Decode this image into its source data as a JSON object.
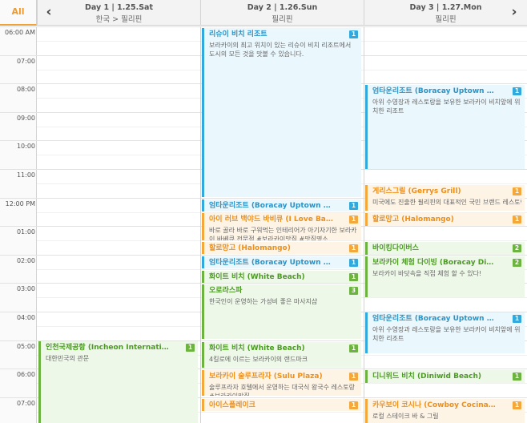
{
  "header": {
    "all_label": "All",
    "prev_icon": "‹",
    "next_icon": "›",
    "days": [
      {
        "title": "Day 1  |  1.25.Sat",
        "subtitle": "한국 > 필리핀"
      },
      {
        "title": "Day 2  |  1.26.Sun",
        "subtitle": "필리핀"
      },
      {
        "title": "Day 3  |  1.27.Mon",
        "subtitle": "필리핀"
      }
    ]
  },
  "times": [
    "06:00 AM",
    "07:00",
    "08:00",
    "09:00",
    "10:00",
    "11:00",
    "12:00 PM",
    "01:00",
    "02:00",
    "03:00",
    "04:00",
    "05:00",
    "06:00",
    "07:00"
  ],
  "colors": {
    "blue": "#32a9dc",
    "orange": "#f4a83c",
    "green": "#6cb33f",
    "accent": "#f09a2c"
  },
  "events": [
    {
      "day": 1,
      "color": "green",
      "title": "인천국제공항 (Incheon Internati…",
      "desc": "대한민국의 관문",
      "badge": "1"
    },
    {
      "day": 2,
      "color": "blue",
      "title": "리슈이 비치 리조트",
      "desc": "보라카이의 최고 위치이 있는 리슈이 비치 리조트에서 도시의 모든 것을 맛볼 수 있습니다.",
      "badge": "1"
    },
    {
      "day": 2,
      "color": "blue",
      "title": "엄타운리조트 (Boracay Uptown …",
      "desc": "",
      "badge": "1"
    },
    {
      "day": 2,
      "color": "orange",
      "title": "아이 러브 백야드 바비큐 (I Love Ba…",
      "desc": "바로 골라 바로 구워먹는 인테리어가 아기자기한 보라카이 바베큐 전문점 #보라카이맛집 #맛집명소",
      "badge": "1"
    },
    {
      "day": 2,
      "color": "orange",
      "title": "할로망고 (Halomango)",
      "desc": "",
      "badge": "1"
    },
    {
      "day": 2,
      "color": "blue",
      "title": "엄타운리조트 (Boracay Uptown …",
      "desc": "",
      "badge": "1"
    },
    {
      "day": 2,
      "color": "green",
      "title": "화이트 비치 (White Beach)",
      "desc": "",
      "badge": "1"
    },
    {
      "day": 2,
      "color": "green",
      "title": "오로라스파",
      "desc": "한국인이 운영하는 가성비 좋은 마사지샵",
      "badge": "3"
    },
    {
      "day": 2,
      "color": "green",
      "title": "화이트 비치 (White Beach)",
      "desc": "4킬로에 이르는 보라카이의 랜드마크",
      "badge": "1"
    },
    {
      "day": 2,
      "color": "orange",
      "title": "보라카이 술루프라자 (Sulu Plaza)",
      "desc": "술루프라자 호텔에서 운영하는 대국식 왕국수 레스토랑 #보라카이맛집",
      "badge": "1"
    },
    {
      "day": 2,
      "color": "orange",
      "title": "아이스플레이크",
      "desc": "",
      "badge": "1"
    },
    {
      "day": 3,
      "color": "blue",
      "title": "엄타운리조트 (Boracay Uptown …",
      "desc": "아위 수영장과 레스토랑을 보유한 보라카이 비치앞에 위치한 리조트",
      "badge": "1"
    },
    {
      "day": 3,
      "color": "orange",
      "title": "게리스그릴 (Gerrys Grill)",
      "desc": "미국에도 진출한 필리핀의 대표적인 국민 브랜드 레스토랑",
      "badge": "1"
    },
    {
      "day": 3,
      "color": "orange",
      "title": "할로망고 (Halomango)",
      "desc": "",
      "badge": "1"
    },
    {
      "day": 3,
      "color": "green",
      "title": "바이킹다이버스",
      "desc": "",
      "badge": "2"
    },
    {
      "day": 3,
      "color": "green",
      "title": "보라카이 체험 다이빙 (Boracay Di…",
      "desc": "보라카이 바닷속을 직접 체험 할 수 있다!",
      "badge": "2"
    },
    {
      "day": 3,
      "color": "blue",
      "title": "엄타운리조트 (Boracay Uptown …",
      "desc": "아위 수영장과 레스토랑을 보유한 보라카이 비치앞에 위치한 리조트",
      "badge": "1"
    },
    {
      "day": 3,
      "color": "green",
      "title": "디니위드 비치 (Diniwid Beach)",
      "desc": "",
      "badge": "1"
    },
    {
      "day": 3,
      "color": "orange",
      "title": "카우보이 코시나 (Cowboy Cocina…",
      "desc": "로컬 스테이크 바 & 그릴",
      "badge": "1"
    }
  ]
}
